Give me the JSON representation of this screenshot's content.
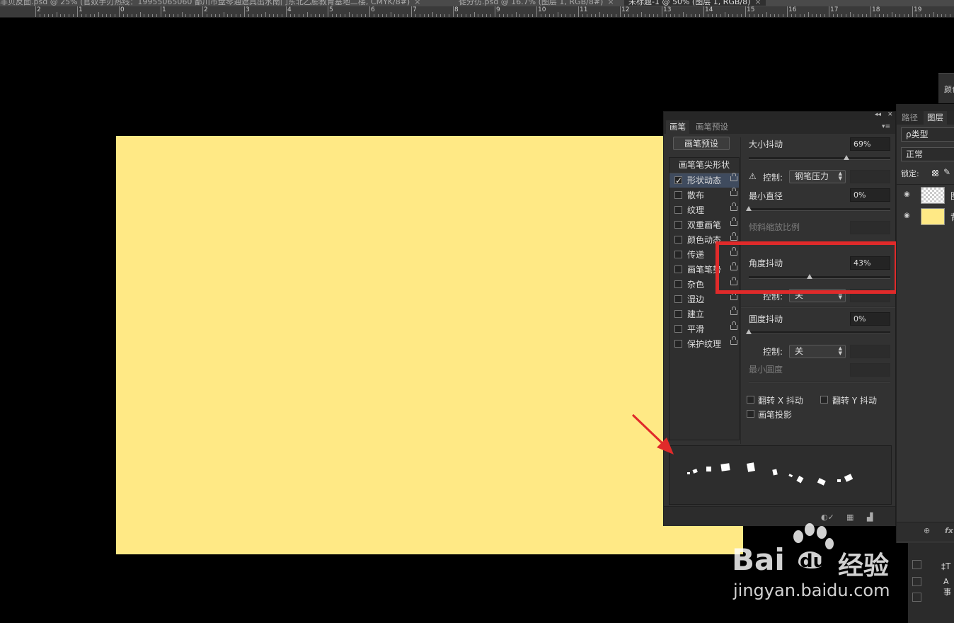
{
  "document_tabs": [
    {
      "label": "非贝反面.psd @ 25% (官奴手刃热线：19955065060 鄱川市盘琴通遮具出水南门东北乙膨教育基地二楼, CMYK/8#)"
    },
    {
      "label": "徒分彷.psd @ 16.7% (图层 1, RGB/8#)"
    },
    {
      "label": "未标题-1 @ 50% (图层 1, RGB/8)"
    }
  ],
  "tab_close_glyph": "×",
  "ruler": {
    "labels": [
      "2",
      "1",
      "0",
      "1",
      "2",
      "3",
      "4",
      "5",
      "6",
      "7",
      "8",
      "9",
      "10",
      "11",
      "12",
      "13",
      "14",
      "15",
      "16",
      "17",
      "18",
      "19"
    ]
  },
  "canvas": {
    "fill_color": "#ffe985"
  },
  "brush_panel": {
    "top_controls": {
      "collapse": "◂◂",
      "close": "✕",
      "menu": "▾≡"
    },
    "tabs": [
      "画笔",
      "画笔预设"
    ],
    "preset_button": "画笔预设",
    "tip_shape": "画笔笔尖形状",
    "list": [
      {
        "label": "形状动态",
        "checked": true,
        "selected": true
      },
      {
        "label": "散布",
        "checked": false
      },
      {
        "label": "纹理",
        "checked": false
      },
      {
        "label": "双重画笔",
        "checked": false
      },
      {
        "label": "颜色动态",
        "checked": false
      },
      {
        "label": "传递",
        "checked": false
      },
      {
        "label": "画笔笔势",
        "checked": false
      },
      {
        "label": "杂色",
        "checked": false
      },
      {
        "label": "湿边",
        "checked": false
      },
      {
        "label": "建立",
        "checked": false
      },
      {
        "label": "平滑",
        "checked": false
      },
      {
        "label": "保护纹理",
        "checked": false
      }
    ],
    "size_jitter": {
      "label": "大小抖动",
      "value": "69%",
      "level": 0.69
    },
    "warning_icon": "⚠",
    "control1": {
      "label": "控制:",
      "value": "钢笔压力"
    },
    "min_diameter": {
      "label": "最小直径",
      "value": "0%",
      "level": 0
    },
    "tilt_scale": {
      "label": "倾斜缩放比例"
    },
    "angle_jitter": {
      "label": "角度抖动",
      "value": "43%",
      "level": 0.43
    },
    "control2": {
      "label": "控制:",
      "value": "关"
    },
    "roundness_jitter": {
      "label": "圆度抖动",
      "value": "0%",
      "level": 0
    },
    "control3": {
      "label": "控制:",
      "value": "关"
    },
    "min_roundness": {
      "label": "最小圆度"
    },
    "flip_x": {
      "label": "翻转 X 抖动",
      "checked": false
    },
    "flip_y": {
      "label": "翻转 Y 抖动",
      "checked": false
    },
    "brush_projection": {
      "label": "画笔投影",
      "checked": false
    },
    "bottom_icons": [
      "◐✓",
      "▦",
      "▟"
    ]
  },
  "highlight_color": "#e02a2a",
  "layers_panel": {
    "tabs": [
      "路径",
      "图层"
    ],
    "filter": "ρ类型",
    "blend_mode": "正常",
    "lock_label": "锁定:",
    "layers": [
      {
        "name": "图",
        "thumb": "transparent"
      },
      {
        "name": "背",
        "thumb": "#ffe985"
      }
    ],
    "bottom_icons": [
      "⊕",
      "fx"
    ]
  },
  "side_strip": {
    "label": "颜色"
  },
  "misc_panel": {
    "items": [
      "‡T",
      "A事"
    ]
  },
  "watermark": {
    "brand": "Bai",
    "brand2": "du",
    "product": "经验",
    "url": "jingyan.baidu.com"
  }
}
